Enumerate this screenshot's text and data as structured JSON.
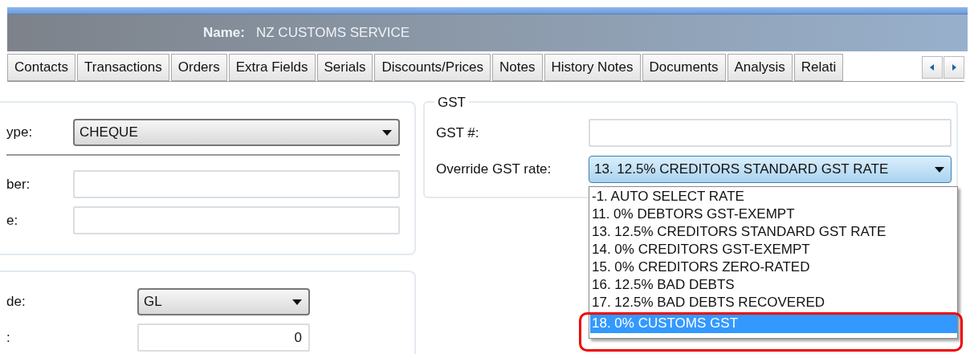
{
  "header": {
    "label": "Name:",
    "value": "NZ CUSTOMS SERVICE"
  },
  "tabs": [
    {
      "label": "Contacts",
      "selected": false
    },
    {
      "label": "Transactions",
      "selected": false
    },
    {
      "label": "Orders",
      "selected": false
    },
    {
      "label": "Extra Fields",
      "selected": false
    },
    {
      "label": "Serials",
      "selected": false
    },
    {
      "label": "Discounts/Prices",
      "selected": false
    },
    {
      "label": "Notes",
      "selected": false
    },
    {
      "label": "History Notes",
      "selected": false
    },
    {
      "label": "Documents",
      "selected": false
    },
    {
      "label": "Analysis",
      "selected": false
    },
    {
      "label": "Relati",
      "selected": false
    }
  ],
  "payment_group": {
    "rows": [
      {
        "kind": "combo",
        "label": "ype:",
        "value": "CHEQUE"
      },
      {
        "kind": "separator"
      },
      {
        "kind": "text",
        "label": "ber:"
      },
      {
        "kind": "text",
        "label": "e:"
      }
    ]
  },
  "code_group": {
    "rows": [
      {
        "kind": "combo",
        "label": "de:",
        "value": "GL"
      },
      {
        "kind": "text",
        "label": ":",
        "value": "0"
      }
    ]
  },
  "gst": {
    "title": "GST",
    "gst_number": {
      "label": "GST #:"
    },
    "override": {
      "label": "Override GST rate:",
      "value": "13. 12.5% CREDITORS STANDARD GST RATE",
      "expanded": true
    },
    "options": [
      {
        "label": "-1. AUTO SELECT RATE",
        "selected": false
      },
      {
        "label": "11. 0% DEBTORS GST-EXEMPT",
        "selected": false
      },
      {
        "label": "13. 12.5% CREDITORS STANDARD GST RATE",
        "selected": false
      },
      {
        "label": "14. 0% CREDITORS GST-EXEMPT",
        "selected": false
      },
      {
        "label": "15. 0% CREDITORS ZERO-RATED",
        "selected": false
      },
      {
        "label": "16. 12.5% BAD DEBTS",
        "selected": false
      },
      {
        "label": "17. 12.5% BAD DEBTS RECOVERED",
        "selected": false
      },
      {
        "label": "18. 0% CUSTOMS GST",
        "selected": true
      }
    ]
  }
}
